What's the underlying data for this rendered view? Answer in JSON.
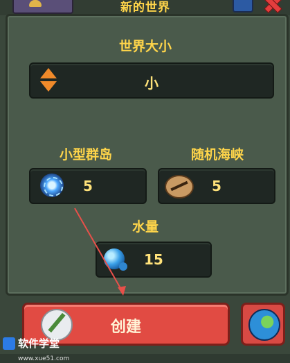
{
  "header": {
    "title": "新的世界"
  },
  "world_size": {
    "label": "世界大小",
    "value": "小"
  },
  "small_islands": {
    "label": "小型群岛",
    "value": "5"
  },
  "random_gorges": {
    "label": "随机海峡",
    "value": "5"
  },
  "water": {
    "label": "水量",
    "value": "15"
  },
  "actions": {
    "create_label": "创建"
  },
  "watermark": {
    "brand": "软件学堂",
    "url": "www.xue51.com"
  },
  "icons": {
    "world_size": "up-down-arrows-icon",
    "small_islands": "vortex-icon",
    "random_gorges": "cracked-rock-icon",
    "water": "water-drop-icon",
    "create": "quill-icon",
    "globe": "globe-icon",
    "close": "close-icon"
  },
  "colors": {
    "accent_text": "#ffd54a",
    "create_button": "#e14b43",
    "panel": "#4a5a4b"
  }
}
